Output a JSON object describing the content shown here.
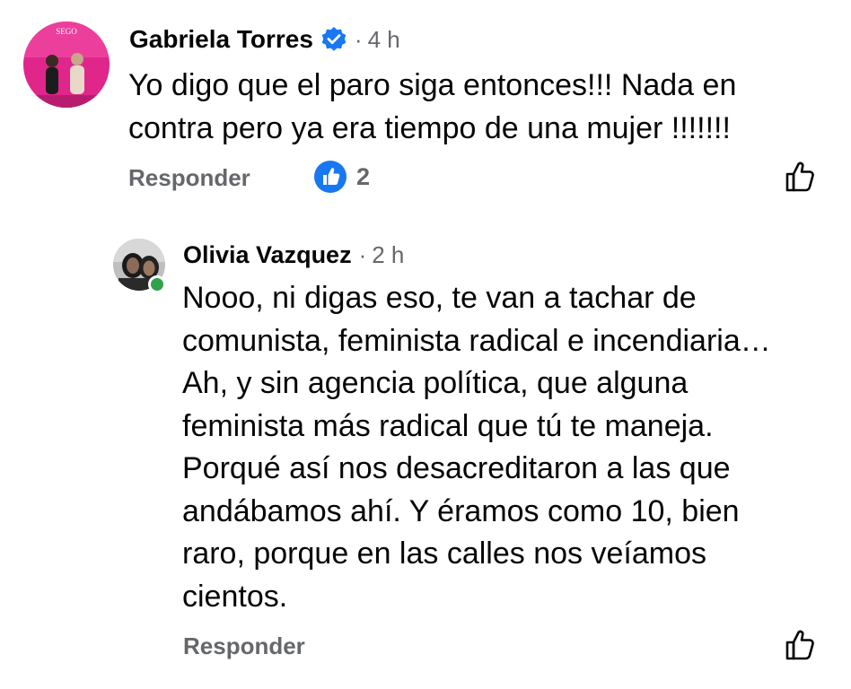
{
  "comments": [
    {
      "author": "Gabriela Torres",
      "time": "4 h",
      "verified": true,
      "lines": [
        "Yo digo que el paro siga entonces!!! Nada en",
        "contra pero ya era tiempo de una mujer !!!!!!!"
      ],
      "reply_label": "Responder",
      "reaction_count": "2",
      "avatar_text": "SEGO"
    },
    {
      "author": "Olivia Vazquez",
      "time": "2 h",
      "online": true,
      "lines": [
        "Nooo, ni digas eso, te van a tachar de",
        "comunista, feminista radical e incendiaria…",
        "Ah, y sin agencia política, que alguna",
        "feminista más radical que tú te maneja.",
        "Porqué así nos desacreditaron a las que",
        "andábamos ahí. Y éramos como 10, bien",
        "raro, porque en las calles nos veíamos",
        "cientos."
      ],
      "reply_label": "Responder"
    }
  ],
  "separator": "·",
  "colors": {
    "primary_text": "#050505",
    "secondary_text": "#65676b",
    "like_blue": "#1877f2",
    "online_green": "#31a24c",
    "avatar_pink": "#e0268a"
  },
  "icons": [
    "verified-badge-icon",
    "like-reaction-icon",
    "like-outline-icon"
  ]
}
